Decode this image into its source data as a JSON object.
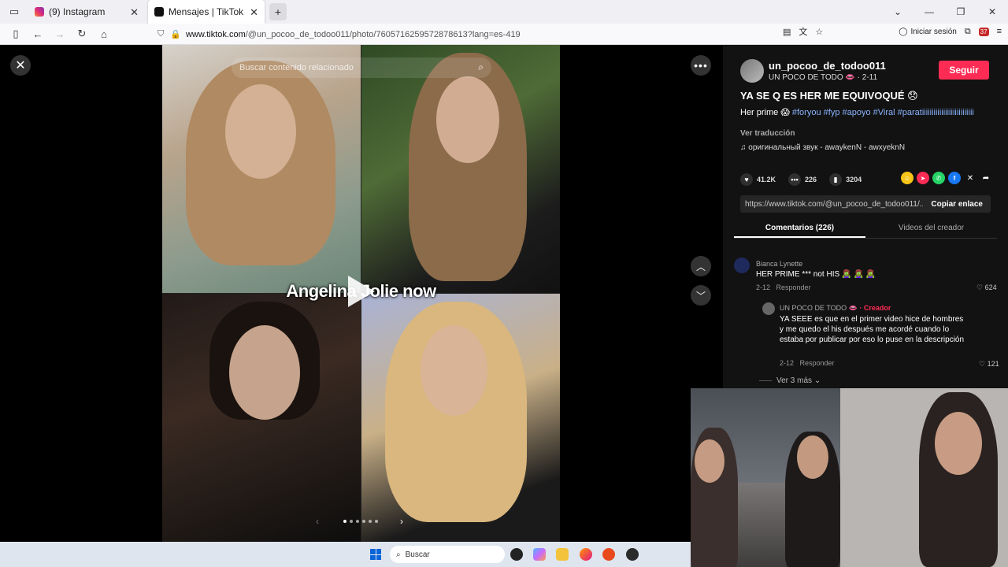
{
  "tabs": [
    {
      "label": "(9) Instagram",
      "color": "#e1306c"
    },
    {
      "label": "Mensajes | TikTok",
      "color": "#111111"
    }
  ],
  "nav": {
    "url_host": "www.tiktok.com",
    "url_path": "/@un_pocoo_de_todoo011/photo/7605716259572878613?lang=es-419",
    "signin": "Iniciar sesión",
    "ext_badge": "37"
  },
  "video": {
    "search_placeholder": "Buscar contenido relacionado",
    "overlay_text": "Angelina Jolie now"
  },
  "post": {
    "username": "un_pocoo_de_todoo011",
    "display": "UN POCO DE TODO 👄 · 2-11",
    "follow": "Seguir",
    "title": "YA SE Q ES HER ME EQUIVOQUÉ 😞",
    "caption_text": "Her prime 😱",
    "hashtags": [
      "#foryou",
      "#fyp",
      "#apoyo",
      "#Viral",
      "#paratiiiiiiiiiiiiiiiiiiiiiiiiiii"
    ],
    "translate": "Ver traducción",
    "music": "♫  оригинальный звук - awaykenN - awxyeknN",
    "likes": "41.2K",
    "comments": "226",
    "saves": "3204",
    "link": "https://www.tiktok.com/@un_pocoo_de_todoo011/...",
    "copy": "Copiar enlace"
  },
  "panel_tabs": [
    "Comentarios (226)",
    "Videos del creador"
  ],
  "comments": [
    {
      "name": "Bianca Lynette",
      "text": "HER PRIME *** not HIS 🧟‍♀️ 🧟‍♀️ 🧟‍♀️",
      "date": "2-12",
      "reply": "Responder",
      "likes": "624"
    },
    {
      "name": "UN POCO DE TODO 👄",
      "creator": "· Creador",
      "text": "YA SEEE es que en el primer video hice de hombres y me quedo el his después me acordé cuando lo estaba por publicar por eso lo puse en la descripción",
      "date": "2-12",
      "reply": "Responder",
      "likes": "121"
    }
  ],
  "view_more": "Ver 3 más",
  "taskbar": {
    "search": "Buscar"
  }
}
